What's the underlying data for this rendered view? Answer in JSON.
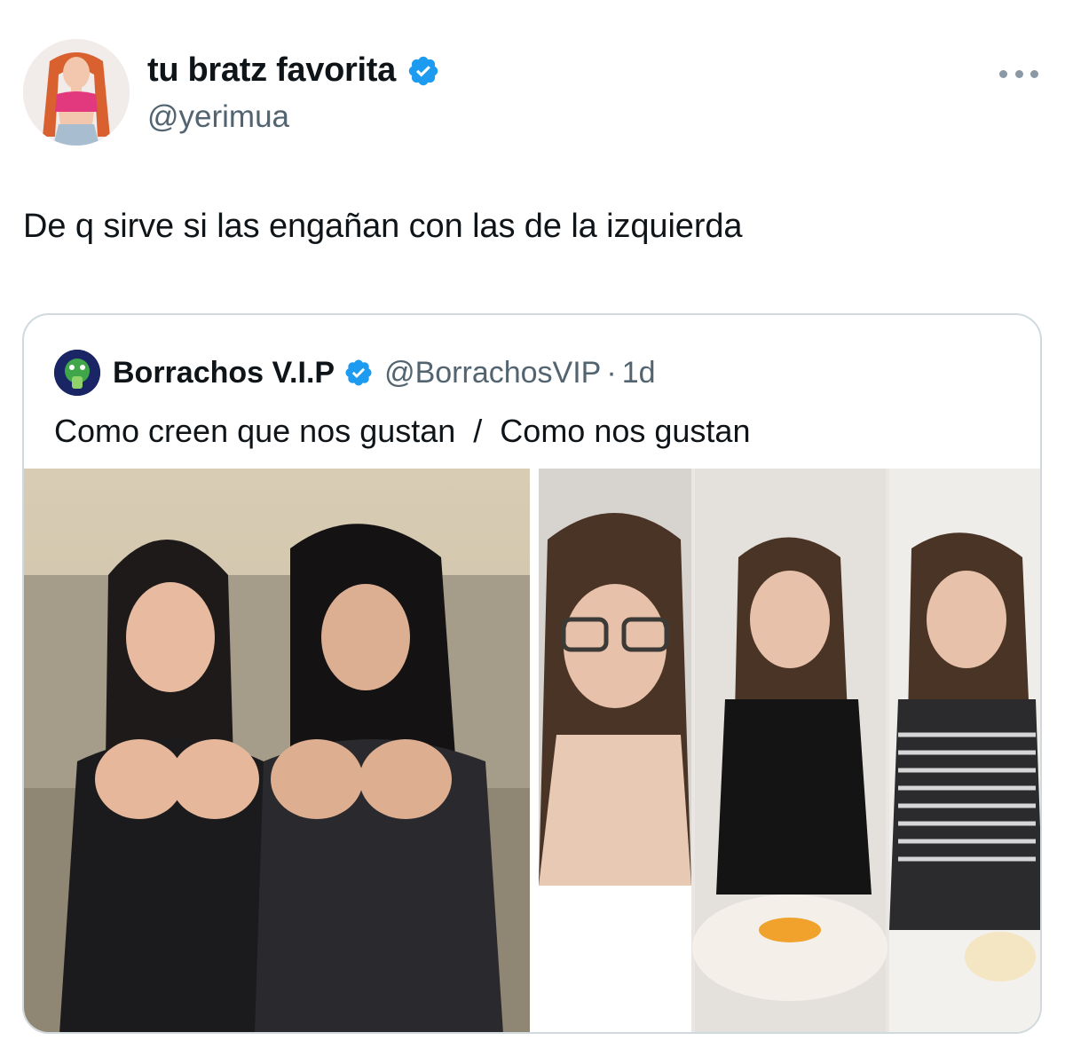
{
  "author": {
    "display_name": "tu bratz favorita",
    "handle": "@yerimua",
    "verified": true,
    "avatar_icon": "profile-photo"
  },
  "tweet": {
    "text": "De q sirve si las engañan con las de la izquierda"
  },
  "quote": {
    "display_name": "Borrachos V.I.P",
    "handle": "@BorrachosVIP",
    "separator": "·",
    "time": "1d",
    "verified": true,
    "text": "Como creen que nos gustan  /  Como nos gustan",
    "media": [
      {
        "icon": "photo-two-women-on-couch"
      },
      {
        "icon": "photo-collage-woman-cooking"
      }
    ]
  },
  "colors": {
    "verified_blue": "#1d9bf0",
    "secondary_text": "#536471",
    "border": "#cfd9de"
  }
}
